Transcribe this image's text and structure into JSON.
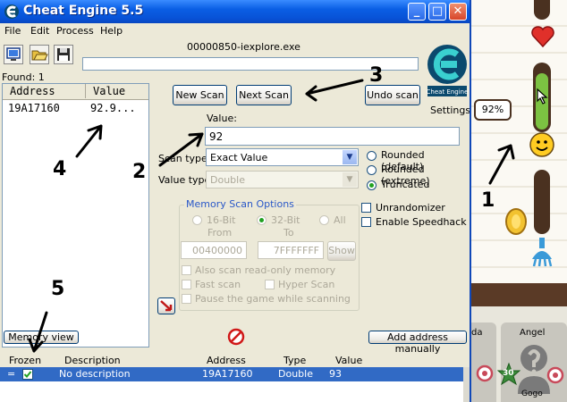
{
  "window": {
    "title": "Cheat Engine 5.5"
  },
  "menu": {
    "file": "File",
    "edit": "Edit",
    "process": "Process",
    "help": "Help"
  },
  "process_name": "00000850-iexplore.exe",
  "found": "Found: 1",
  "results": {
    "headers": {
      "address": "Address",
      "value": "Value"
    },
    "rows": [
      {
        "address": "19A17160",
        "value": "92.9..."
      }
    ]
  },
  "scan": {
    "new_scan": "New Scan",
    "next_scan": "Next Scan",
    "undo_scan": "Undo scan",
    "settings": "Settings",
    "value_label": "Value:",
    "value": "92",
    "scan_type_label": "Scan type",
    "scan_type": "Exact Value",
    "value_type_label": "Value type",
    "value_type": "Double",
    "rounded_default": "Rounded (default)",
    "rounded_extreme": "Rounded (extreme)",
    "truncated": "Truncated"
  },
  "memory_options": {
    "title": "Memory Scan Options",
    "bit16": "16-Bit",
    "bit32": "32-Bit",
    "all": "All",
    "from_label": "From",
    "to_label": "To",
    "from": "00400000",
    "to": "7FFFFFFF",
    "show": "Show",
    "readonly": "Also scan read-only memory",
    "fast": "Fast scan",
    "hyper": "Hyper Scan",
    "pause": "Pause the game while scanning"
  },
  "options": {
    "unrandomizer": "Unrandomizer",
    "speedhack": "Enable Speedhack"
  },
  "bottom": {
    "memory_view": "Memory view",
    "add_address": "Add address manually",
    "headers": {
      "frozen": "Frozen",
      "description": "Description",
      "address": "Address",
      "type": "Type",
      "value": "Value"
    },
    "row": {
      "frozen_marker": "=",
      "description": "No description",
      "address": "19A17160",
      "type": "Double",
      "value": "93"
    }
  },
  "game": {
    "percent": "92%",
    "player_a": "da",
    "player_b": "Angel",
    "level": "30",
    "player_c": "Gogo",
    "happiness_level": 0.92
  },
  "annotations": [
    "1",
    "2",
    "3",
    "4",
    "5"
  ],
  "colors": {
    "titlebar": "#0a5ee4",
    "selection": "#316ac5",
    "heart": "#e0302a",
    "meter": "#7cc242"
  },
  "icons": [
    "cheat-engine-logo-icon",
    "open-process-icon",
    "open-file-icon",
    "save-icon",
    "arrow-pointer-icon",
    "stop-icon",
    "heart-icon",
    "smiley-icon",
    "coin-icon",
    "shower-icon",
    "person-icon"
  ]
}
